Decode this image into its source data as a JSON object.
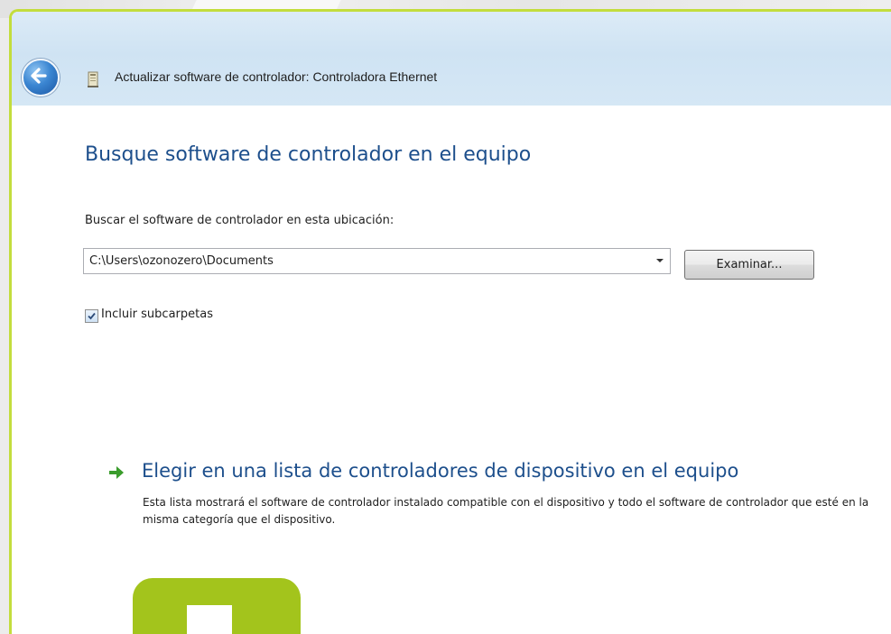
{
  "window": {
    "title": "Actualizar software de controlador: Controladora Ethernet"
  },
  "main": {
    "heading": "Busque software de controlador en el equipo",
    "location_label": "Buscar el software de controlador en esta ubicación:",
    "path_value": "C:\\Users\\ozonozero\\Documents",
    "browse_label": "Examinar...",
    "include_subfolders": {
      "label": "Incluir subcarpetas",
      "checked": true
    },
    "choose_from_list": {
      "title": "Elegir en una lista de controladores de dispositivo en el equipo",
      "description": "Esta lista mostrará el software de controlador instalado compatible con el dispositivo y todo el software de controlador que esté en la misma categoría que el dispositivo."
    }
  },
  "icons": {
    "back": "back-arrow-icon",
    "device": "device-manager-icon",
    "link_arrow": "green-arrow-icon",
    "dropdown": "chevron-down-icon",
    "check": "checkmark-icon"
  },
  "colors": {
    "accent_green": "#c3dd3c",
    "heading_blue": "#1d4f8c",
    "tile_green": "#a3c41c",
    "arrow_green": "#3a9c2c"
  }
}
